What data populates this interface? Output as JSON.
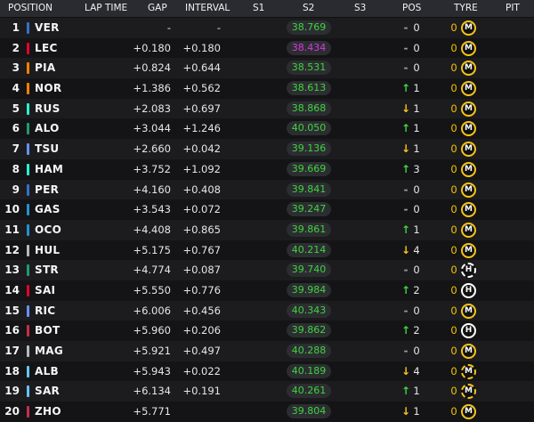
{
  "headers": {
    "position": "POSITION",
    "lap_time": "LAP TIME",
    "gap": "GAP",
    "interval": "INTERVAL",
    "s1": "S1",
    "s2": "S2",
    "s3": "S3",
    "pos": "POS",
    "tyre": "TYRE",
    "pit": "PIT"
  },
  "colors": {
    "s2_green": "#3fd43f",
    "s2_purple": "#d838e0",
    "up": "#3fd43f",
    "down": "#f5c518",
    "same": "#9a9a9a"
  },
  "rows": [
    {
      "position": "1",
      "code": "VER",
      "team_color": "#3671c6",
      "gap": "-",
      "interval": "-",
      "s2": "38.769",
      "s2_color": "green",
      "pos_arrow": "-",
      "pos_dir": "same",
      "pos_change": "0",
      "pits": "0",
      "tyre": "M",
      "tyre_type": "medium"
    },
    {
      "position": "2",
      "code": "LEC",
      "team_color": "#e8002d",
      "gap": "+0.180",
      "interval": "+0.180",
      "s2": "38.434",
      "s2_color": "purple",
      "pos_arrow": "-",
      "pos_dir": "same",
      "pos_change": "0",
      "pits": "0",
      "tyre": "M",
      "tyre_type": "medium"
    },
    {
      "position": "3",
      "code": "PIA",
      "team_color": "#ff8000",
      "gap": "+0.824",
      "interval": "+0.644",
      "s2": "38.531",
      "s2_color": "green",
      "pos_arrow": "-",
      "pos_dir": "same",
      "pos_change": "0",
      "pits": "0",
      "tyre": "M",
      "tyre_type": "medium"
    },
    {
      "position": "4",
      "code": "NOR",
      "team_color": "#ff8000",
      "gap": "+1.386",
      "interval": "+0.562",
      "s2": "38.613",
      "s2_color": "green",
      "pos_arrow": "↑",
      "pos_dir": "up",
      "pos_change": "1",
      "pits": "0",
      "tyre": "M",
      "tyre_type": "medium"
    },
    {
      "position": "5",
      "code": "RUS",
      "team_color": "#27f4d2",
      "gap": "+2.083",
      "interval": "+0.697",
      "s2": "38.868",
      "s2_color": "green",
      "pos_arrow": "↓",
      "pos_dir": "down",
      "pos_change": "1",
      "pits": "0",
      "tyre": "M",
      "tyre_type": "medium"
    },
    {
      "position": "6",
      "code": "ALO",
      "team_color": "#229971",
      "gap": "+3.044",
      "interval": "+1.246",
      "s2": "40.050",
      "s2_color": "green",
      "pos_arrow": "↑",
      "pos_dir": "up",
      "pos_change": "1",
      "pits": "0",
      "tyre": "M",
      "tyre_type": "medium"
    },
    {
      "position": "7",
      "code": "TSU",
      "team_color": "#6692ff",
      "gap": "+2.660",
      "interval": "+0.042",
      "s2": "39.136",
      "s2_color": "green",
      "pos_arrow": "↓",
      "pos_dir": "down",
      "pos_change": "1",
      "pits": "0",
      "tyre": "M",
      "tyre_type": "medium"
    },
    {
      "position": "8",
      "code": "HAM",
      "team_color": "#27f4d2",
      "gap": "+3.752",
      "interval": "+1.092",
      "s2": "39.669",
      "s2_color": "green",
      "pos_arrow": "↑",
      "pos_dir": "up",
      "pos_change": "3",
      "pits": "0",
      "tyre": "M",
      "tyre_type": "medium"
    },
    {
      "position": "9",
      "code": "PER",
      "team_color": "#3671c6",
      "gap": "+4.160",
      "interval": "+0.408",
      "s2": "39.841",
      "s2_color": "green",
      "pos_arrow": "-",
      "pos_dir": "same",
      "pos_change": "0",
      "pits": "0",
      "tyre": "M",
      "tyre_type": "medium"
    },
    {
      "position": "10",
      "code": "GAS",
      "team_color": "#2293d1",
      "gap": "+3.543",
      "interval": "+0.072",
      "s2": "39.247",
      "s2_color": "green",
      "pos_arrow": "-",
      "pos_dir": "same",
      "pos_change": "0",
      "pits": "0",
      "tyre": "M",
      "tyre_type": "medium"
    },
    {
      "position": "11",
      "code": "OCO",
      "team_color": "#2293d1",
      "gap": "+4.408",
      "interval": "+0.865",
      "s2": "39.861",
      "s2_color": "green",
      "pos_arrow": "↑",
      "pos_dir": "up",
      "pos_change": "1",
      "pits": "0",
      "tyre": "M",
      "tyre_type": "medium"
    },
    {
      "position": "12",
      "code": "HUL",
      "team_color": "#b6babd",
      "gap": "+5.175",
      "interval": "+0.767",
      "s2": "40.214",
      "s2_color": "green",
      "pos_arrow": "↓",
      "pos_dir": "down",
      "pos_change": "4",
      "pits": "0",
      "tyre": "M",
      "tyre_type": "medium"
    },
    {
      "position": "13",
      "code": "STR",
      "team_color": "#229971",
      "gap": "+4.774",
      "interval": "+0.087",
      "s2": "39.740",
      "s2_color": "green",
      "pos_arrow": "-",
      "pos_dir": "same",
      "pos_change": "0",
      "pits": "0",
      "tyre": "H",
      "tyre_type": "hard_used"
    },
    {
      "position": "14",
      "code": "SAI",
      "team_color": "#e8002d",
      "gap": "+5.550",
      "interval": "+0.776",
      "s2": "39.984",
      "s2_color": "green",
      "pos_arrow": "↑",
      "pos_dir": "up",
      "pos_change": "2",
      "pits": "0",
      "tyre": "H",
      "tyre_type": "hard"
    },
    {
      "position": "15",
      "code": "RIC",
      "team_color": "#6692ff",
      "gap": "+6.006",
      "interval": "+0.456",
      "s2": "40.343",
      "s2_color": "green",
      "pos_arrow": "-",
      "pos_dir": "same",
      "pos_change": "0",
      "pits": "0",
      "tyre": "M",
      "tyre_type": "medium"
    },
    {
      "position": "16",
      "code": "BOT",
      "team_color": "#c92d4b",
      "gap": "+5.960",
      "interval": "+0.206",
      "s2": "39.862",
      "s2_color": "green",
      "pos_arrow": "↑",
      "pos_dir": "up",
      "pos_change": "2",
      "pits": "0",
      "tyre": "H",
      "tyre_type": "hard"
    },
    {
      "position": "17",
      "code": "MAG",
      "team_color": "#b6babd",
      "gap": "+5.921",
      "interval": "+0.497",
      "s2": "40.288",
      "s2_color": "green",
      "pos_arrow": "-",
      "pos_dir": "same",
      "pos_change": "0",
      "pits": "0",
      "tyre": "M",
      "tyre_type": "medium"
    },
    {
      "position": "18",
      "code": "ALB",
      "team_color": "#64c4ff",
      "gap": "+5.943",
      "interval": "+0.022",
      "s2": "40.189",
      "s2_color": "green",
      "pos_arrow": "↓",
      "pos_dir": "down",
      "pos_change": "4",
      "pits": "0",
      "tyre": "M",
      "tyre_type": "medium_used"
    },
    {
      "position": "19",
      "code": "SAR",
      "team_color": "#64c4ff",
      "gap": "+6.134",
      "interval": "+0.191",
      "s2": "40.261",
      "s2_color": "green",
      "pos_arrow": "↑",
      "pos_dir": "up",
      "pos_change": "1",
      "pits": "0",
      "tyre": "M",
      "tyre_type": "medium_used"
    },
    {
      "position": "20",
      "code": "ZHO",
      "team_color": "#c92d4b",
      "gap": "+5.771",
      "interval": "",
      "s2": "39.804",
      "s2_color": "green",
      "pos_arrow": "↓",
      "pos_dir": "down",
      "pos_change": "1",
      "pits": "0",
      "tyre": "M",
      "tyre_type": "medium"
    }
  ]
}
